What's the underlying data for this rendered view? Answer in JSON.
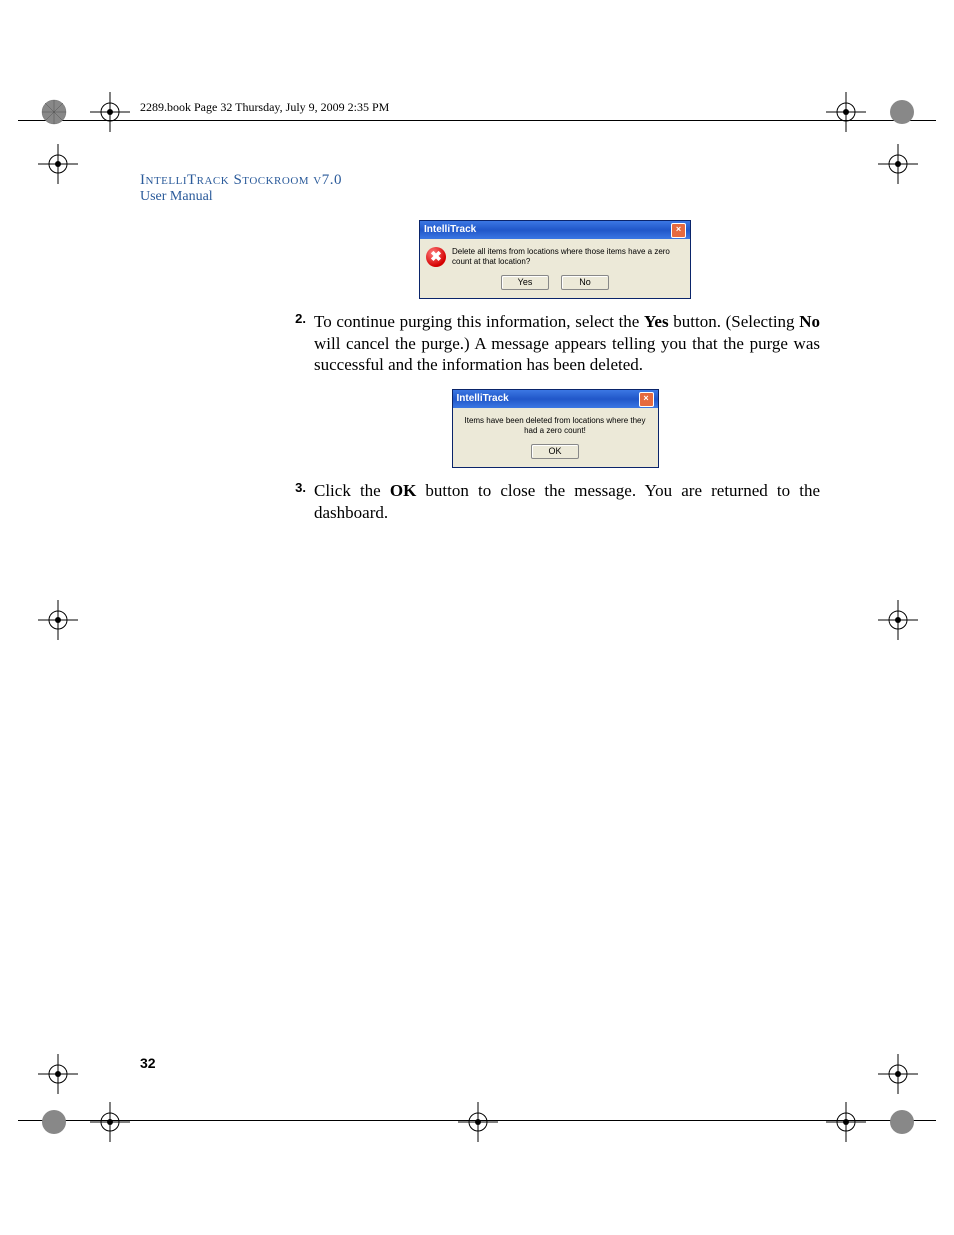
{
  "header": {
    "text": "2289.book  Page 32  Thursday, July 9, 2009  2:35 PM"
  },
  "title": {
    "line1": "IntelliTrack Stockroom v7.0",
    "line2": "User Manual"
  },
  "dialog1": {
    "title": "IntelliTrack",
    "message": "Delete all items from locations where those items have a zero count at that location?",
    "yes": "Yes",
    "no": "No"
  },
  "step2": {
    "num": "2.",
    "pre": "To continue purging this information, select the ",
    "yes": "Yes",
    "mid": " button. (Selecting ",
    "no": "No",
    "post": " will cancel the purge.) A message appears telling you that the purge was successful and the information has been deleted."
  },
  "dialog2": {
    "title": "IntelliTrack",
    "message": "Items have been deleted from locations where they had a zero count!",
    "ok": "OK"
  },
  "step3": {
    "num": "3.",
    "pre": "Click the ",
    "ok": "OK",
    "post": " button to close the message. You are returned to the dashboard."
  },
  "page": {
    "num": "32"
  }
}
